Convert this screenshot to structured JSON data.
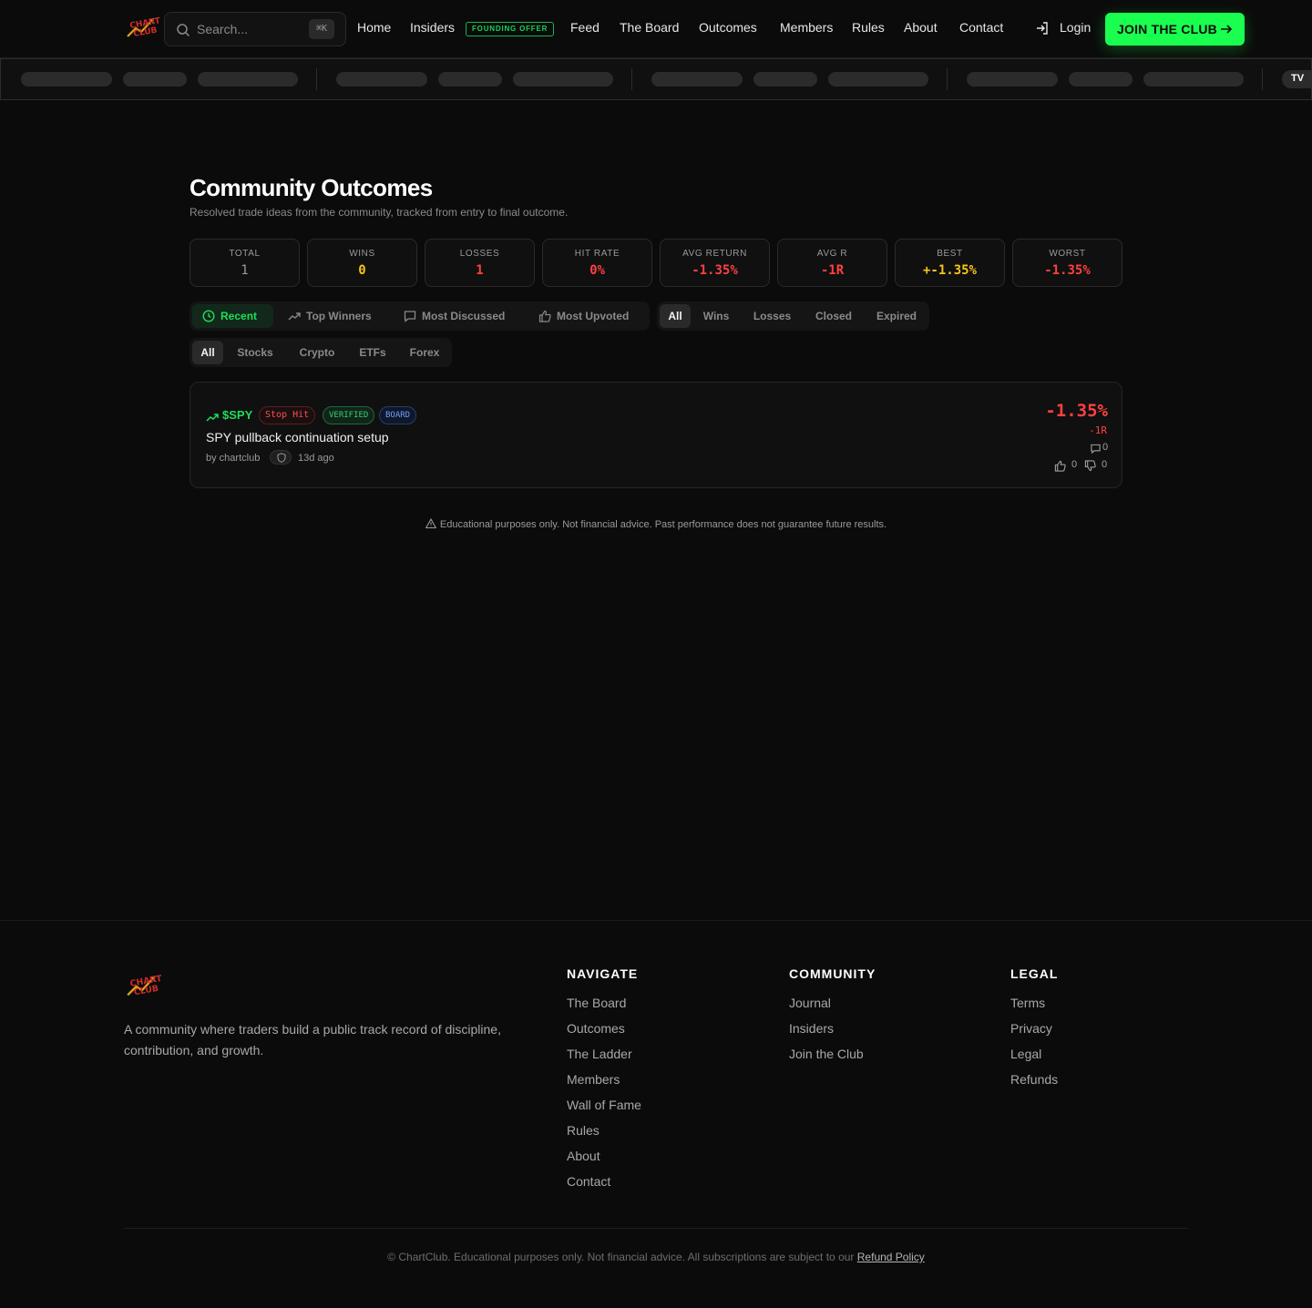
{
  "brand": {
    "logo_text": "CHART CLUB",
    "accent": "#1aff4f"
  },
  "header": {
    "search": {
      "placeholder": "Search...",
      "shortcut": "⌘K",
      "icon": "search-icon"
    },
    "nav": [
      {
        "label": "Home"
      },
      {
        "label": "Insiders"
      },
      {
        "label": "Feed"
      },
      {
        "label": "The Board"
      },
      {
        "label": "Outcomes"
      },
      {
        "label": "Members"
      },
      {
        "label": "Rules"
      },
      {
        "label": "About"
      },
      {
        "label": "Contact"
      }
    ],
    "founding_badge": "FOUNDING OFFER",
    "login_label": "Login",
    "join_label": "JOIN THE CLUB"
  },
  "ticker": {
    "badge": "TV"
  },
  "main": {
    "title": "Community Outcomes",
    "subtitle": "Resolved trade ideas from the community, tracked from entry to final outcome.",
    "stats": [
      {
        "label": "TOTAL",
        "value": "1",
        "color": "#9a9a9a"
      },
      {
        "label": "WINS",
        "value": "0",
        "color": "#f5c518"
      },
      {
        "label": "LOSSES",
        "value": "1",
        "color": "#ff4040"
      },
      {
        "label": "HIT RATE",
        "value": "0%",
        "color": "#ff4040"
      },
      {
        "label": "AVG RETURN",
        "value": "-1.35%",
        "color": "#ff4040"
      },
      {
        "label": "AVG R",
        "value": "-1R",
        "color": "#ff4040"
      },
      {
        "label": "BEST",
        "value": "+-1.35%",
        "color": "#f5c518"
      },
      {
        "label": "WORST",
        "value": "-1.35%",
        "color": "#ff4040"
      }
    ],
    "sort_tabs": [
      {
        "label": "Recent",
        "icon": "clock-icon",
        "active": true
      },
      {
        "label": "Top Winners",
        "icon": "trending-up-icon",
        "active": false
      },
      {
        "label": "Most Discussed",
        "icon": "comment-icon",
        "active": false
      },
      {
        "label": "Most Upvoted",
        "icon": "thumbs-up-icon",
        "active": false
      }
    ],
    "status_tabs": [
      {
        "label": "All",
        "active": true
      },
      {
        "label": "Wins",
        "active": false
      },
      {
        "label": "Losses",
        "active": false
      },
      {
        "label": "Closed",
        "active": false
      },
      {
        "label": "Expired",
        "active": false
      }
    ],
    "asset_tabs": [
      {
        "label": "All",
        "active": true
      },
      {
        "label": "Stocks",
        "active": false
      },
      {
        "label": "Crypto",
        "active": false
      },
      {
        "label": "ETFs",
        "active": false
      },
      {
        "label": "Forex",
        "active": false
      }
    ],
    "outcomes": [
      {
        "symbol": "$SPY",
        "status": "Stop Hit",
        "verified": "VERIFIED",
        "source": "BOARD",
        "title": "SPY pullback continuation setup",
        "author": "by chartclub",
        "age": "13d ago",
        "return": "-1.35%",
        "r_multiple": "-1R",
        "comments": "0",
        "upvotes": "0",
        "downvotes": "0"
      }
    ],
    "disclaimer": "Educational purposes only. Not financial advice. Past performance does not guarantee future results."
  },
  "footer": {
    "description": "A community where traders build a public track record of discipline, contribution, and growth.",
    "columns": [
      {
        "heading": "NAVIGATE",
        "links": [
          "The Board",
          "Outcomes",
          "The Ladder",
          "Members",
          "Wall of Fame",
          "Rules",
          "About",
          "Contact"
        ]
      },
      {
        "heading": "COMMUNITY",
        "links": [
          "Journal",
          "Insiders",
          "Join the Club"
        ]
      },
      {
        "heading": "LEGAL",
        "links": [
          "Terms",
          "Privacy",
          "Legal",
          "Refunds"
        ]
      }
    ],
    "copyright": "© ChartClub. Educational purposes only. Not financial advice. All subscriptions are subject to our",
    "refund_link": "Refund Policy"
  }
}
